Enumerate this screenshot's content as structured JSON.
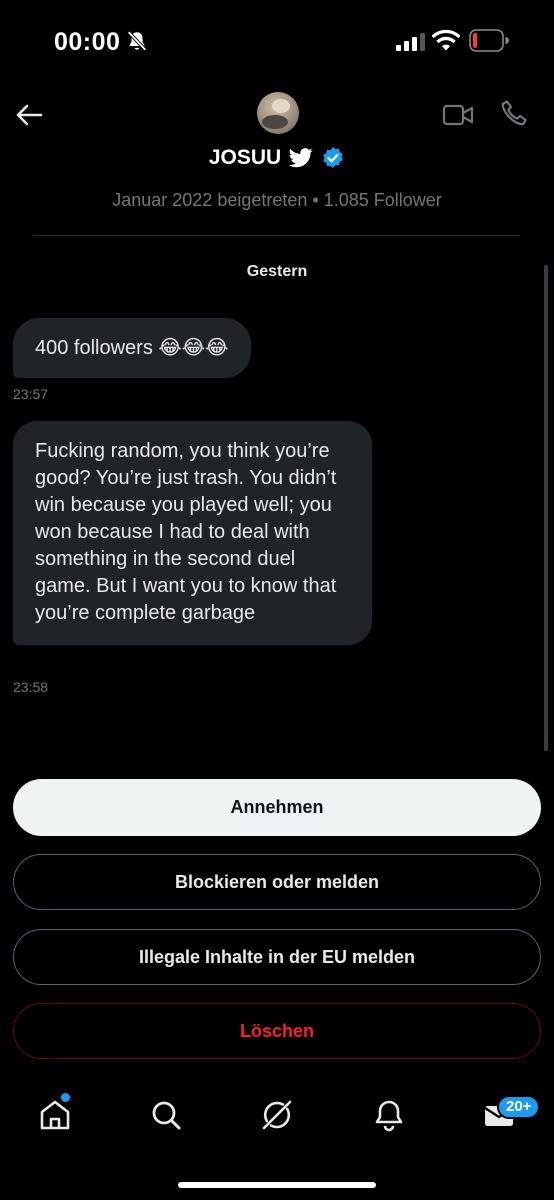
{
  "status_bar": {
    "time": "00:00",
    "icons": [
      "bell-off-icon",
      "cellular-signal-icon",
      "wifi-icon",
      "battery-low-icon"
    ]
  },
  "header": {
    "profile_name": "JOSUU",
    "meta": "Januar 2022 beigetreten • 1.085 Follower",
    "icons": [
      "back-arrow-icon",
      "avatar",
      "twitter-bird-icon",
      "verified-badge-icon",
      "video-call-icon",
      "phone-call-icon"
    ]
  },
  "conversation": {
    "date_label": "Gestern",
    "messages": [
      {
        "text": "400 followers 😂😂😂",
        "time": "23:57"
      },
      {
        "text": "Fucking random, you think you’re good? You’re just trash. You didn’t win because you played well; you won because I had to deal with something in the second duel game. But I want you to know that you’re complete garbage",
        "time": "23:58"
      }
    ]
  },
  "actions": {
    "accept": "Annehmen",
    "block": "Blockieren oder melden",
    "report_eu": "Illegale Inhalte in der EU melden",
    "delete": "Löschen"
  },
  "bottom_nav": {
    "items": [
      "home-icon",
      "search-icon",
      "grok-icon",
      "notifications-icon",
      "messages-icon"
    ],
    "messages_badge": "20+"
  },
  "colors": {
    "background": "#000000",
    "bubble": "#202327",
    "accent": "#1d9bf0",
    "danger": "#f4212e",
    "muted_text": "#71767b"
  }
}
